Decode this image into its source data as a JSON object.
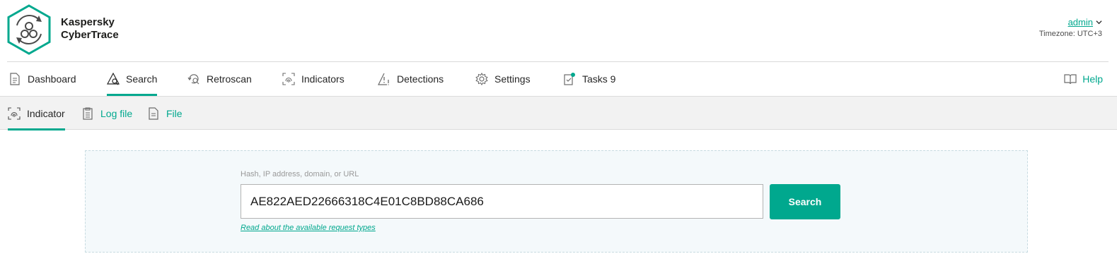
{
  "brand": {
    "line1": "Kaspersky",
    "line2": "CyberTrace"
  },
  "user": {
    "name": "admin",
    "timezone": "Timezone: UTC+3"
  },
  "nav": {
    "dashboard": "Dashboard",
    "search": "Search",
    "retroscan": "Retroscan",
    "indicators": "Indicators",
    "detections": "Detections",
    "settings": "Settings",
    "tasks": "Tasks 9",
    "help": "Help",
    "active": "Search"
  },
  "subnav": {
    "indicator": "Indicator",
    "log_file": "Log file",
    "file": "File",
    "active": "Indicator"
  },
  "search": {
    "label": "Hash, IP address, domain, or URL",
    "value": "AE822AED22666318C4E01C8BD88CA686",
    "button": "Search",
    "request_types_link": "Read about the available request types"
  },
  "colors": {
    "accent": "#00a88e",
    "subnav_bg": "#f2f2f2",
    "panel_bg": "#f4f9fb"
  },
  "icons": [
    "logo-icon",
    "chevron-down-icon",
    "document-icon",
    "search-icon",
    "retroscan-icon",
    "fingerprint-icon",
    "warning-icon",
    "gear-icon",
    "clipboard-check-icon",
    "book-icon",
    "fingerprint-icon",
    "log-file-icon",
    "file-icon"
  ]
}
